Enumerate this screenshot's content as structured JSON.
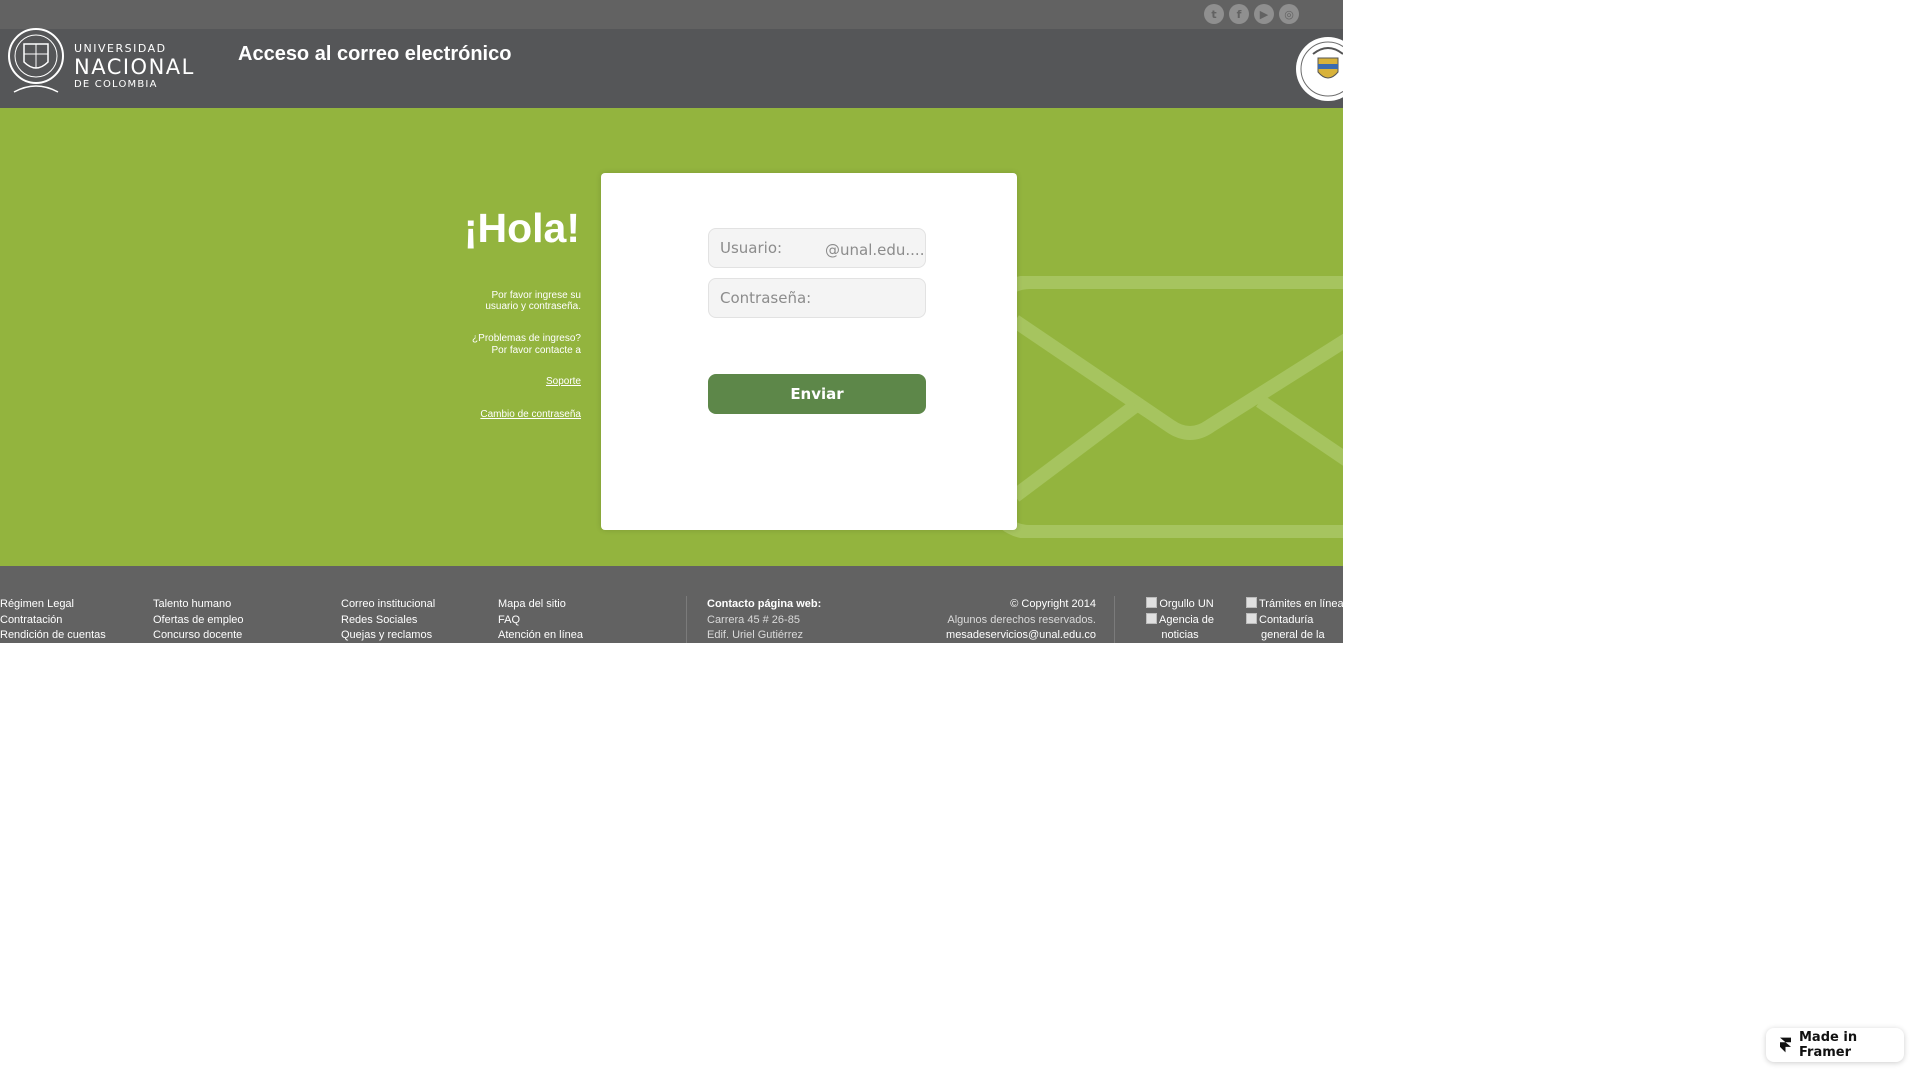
{
  "social": [
    {
      "name": "twitter",
      "glyph": "t"
    },
    {
      "name": "facebook",
      "glyph": "f"
    },
    {
      "name": "youtube",
      "glyph": "▶"
    },
    {
      "name": "instagram",
      "glyph": "◎"
    }
  ],
  "logo": {
    "line1": "UNIVERSIDAD",
    "line2": "NACIONAL",
    "line3": "DE COLOMBIA"
  },
  "header": {
    "title": "Acceso al correo electrónico"
  },
  "hero": {
    "greeting": "¡Hola!",
    "instruction_1": "Por favor ingrese su",
    "instruction_2": "usuario y contraseña.",
    "problem_1": "¿Problemas de ingreso?",
    "problem_2": "Por favor contacte a",
    "support_link": "Soporte",
    "password_change_link": "Cambio de contraseña"
  },
  "login": {
    "user_placeholder": "Usuario:",
    "user_suffix": "@unal.edu....",
    "password_placeholder": "Contraseña:",
    "submit_label": "Enviar"
  },
  "footer": {
    "col1": [
      "Régimen Legal",
      "Contratación",
      "Rendición de cuentas"
    ],
    "col2": [
      "Talento humano",
      "Ofertas de empleo",
      "Concurso docente"
    ],
    "col3": [
      "Correo institucional",
      "Redes Sociales",
      "Quejas y reclamos"
    ],
    "col4": [
      "Mapa del sitio",
      "FAQ",
      "Atención en línea"
    ],
    "contact_title": "Contacto página web:",
    "contact_address": "Carrera 45 # 26-85",
    "contact_building": "Edif. Uriel Gutiérrez",
    "copyright": "© Copyright 2014",
    "rights": "Algunos derechos reservados.",
    "email": "mesadeservicios@unal.edu.co",
    "logo_alt_1a": "Orgullo UN",
    "logo_alt_1b": "Agencia de",
    "logo_alt_1c": "noticias",
    "logo_alt_2a": "Trámites en línea",
    "logo_alt_2b": "Contaduría",
    "logo_alt_2c": "general de la"
  },
  "framer": {
    "label": "Made in Framer"
  },
  "colors": {
    "green": "#93b43e",
    "header": "#555658",
    "button": "#5d8749",
    "footer": "#626262"
  }
}
